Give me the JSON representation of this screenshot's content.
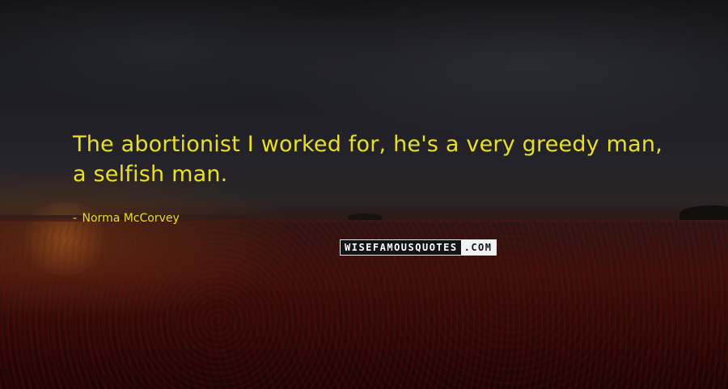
{
  "quote": {
    "text": "The abortionist I worked for, he's a very greedy man, a selfish man."
  },
  "author": {
    "dash": "-",
    "name": "Norma McCorvey"
  },
  "watermark": {
    "part1": "WISEFAMOUSQUOTES",
    "part2": ".COM"
  },
  "colors": {
    "text_accent": "#e8e021"
  }
}
